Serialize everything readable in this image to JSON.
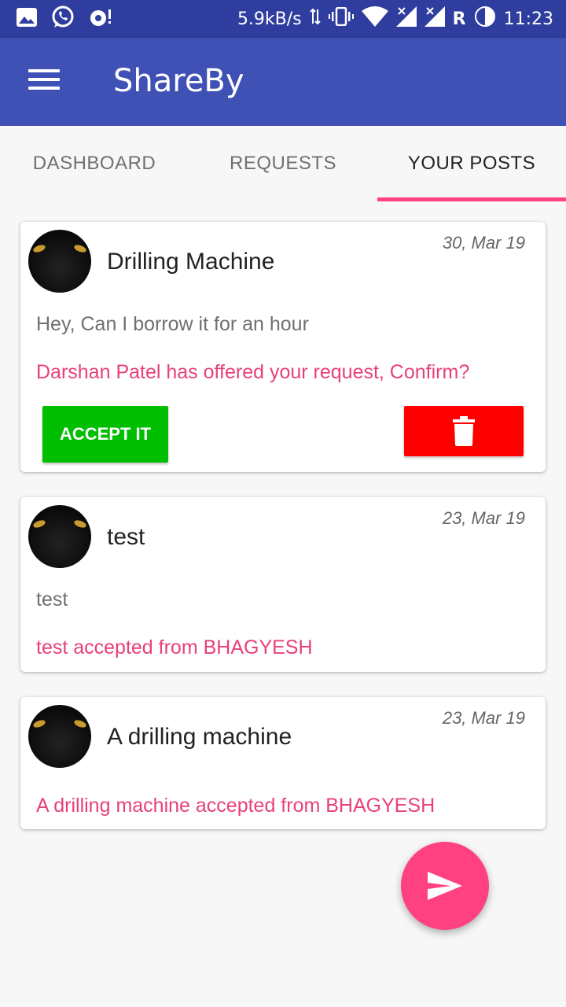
{
  "status_bar": {
    "speed": "5.9kB/s",
    "carrier_letter": "R",
    "time": "11:23",
    "icons": [
      "image-icon",
      "whatsapp-icon",
      "sync-icon",
      "data-arrows-icon",
      "vibrate-icon",
      "wifi-icon",
      "signal-icon",
      "signal-icon",
      "battery-icon"
    ]
  },
  "app_bar": {
    "title": "ShareBy",
    "menu_icon": "hamburger-menu-icon",
    "color": "#3f51b5"
  },
  "tabs": [
    {
      "label": "DASHBOARD",
      "active": false
    },
    {
      "label": "REQUESTS",
      "active": false
    },
    {
      "label": "YOUR POSTS",
      "active": true
    }
  ],
  "accent_color": "#ff4081",
  "posts": [
    {
      "title": "Drilling Machine",
      "date": "30, Mar 19",
      "message": "Hey, Can I borrow it for an hour",
      "status": "Darshan Patel has offered your request, Confirm?",
      "accept_label": "ACCEPT IT",
      "delete_icon": "trash-icon"
    },
    {
      "title": "test",
      "date": "23, Mar 19",
      "message": "test",
      "status": "test accepted from BHAGYESH"
    },
    {
      "title": "A drilling machine",
      "date": "23, Mar 19",
      "message": "",
      "status": "A drilling machine accepted from BHAGYESH"
    }
  ],
  "fab": {
    "icon": "send-icon"
  }
}
